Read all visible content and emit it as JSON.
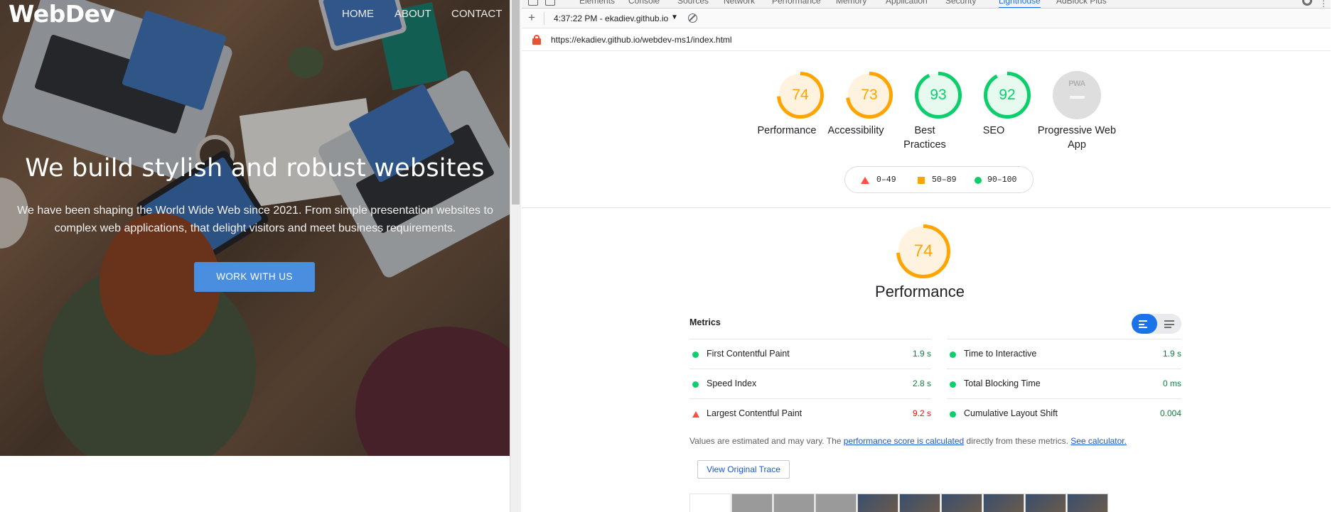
{
  "site": {
    "brand": "WebDev",
    "nav": [
      "HOME",
      "ABOUT",
      "CONTACT"
    ],
    "hero_title": "We build stylish and robust websites",
    "hero_subtitle": "We have been shaping the World Wide Web since 2021. From simple presentation websites to complex web applications, that delight visitors and meet business requirements.",
    "cta_label": "WORK WITH US"
  },
  "devtools": {
    "tabs": [
      "Elements",
      "Console",
      "Sources",
      "Network",
      "Performance",
      "Memory",
      "Application",
      "Security",
      "Lighthouse",
      "AdBlock Plus"
    ],
    "active_tab": "Lighthouse",
    "report_selector": "4:37:22 PM - ekadiev.github.io",
    "url": "https://ekadiev.github.io/webdev-ms1/index.html"
  },
  "gauges": [
    {
      "score": 74,
      "label": "Performance",
      "color": "#ffa400",
      "fill": "#fff3e0"
    },
    {
      "score": 73,
      "label": "Accessibility",
      "color": "#ffa400",
      "fill": "#fff3e0"
    },
    {
      "score": 93,
      "label": "Best Practices",
      "color": "#0cce6b",
      "fill": "#e6faef"
    },
    {
      "score": 92,
      "label": "SEO",
      "color": "#0cce6b",
      "fill": "#e6faef"
    }
  ],
  "pwa": {
    "badge": "PWA",
    "label": "Progressive Web App"
  },
  "legend": [
    {
      "range": "0–49",
      "color": "#ff4e42"
    },
    {
      "range": "50–89",
      "color": "#ffa400"
    },
    {
      "range": "90–100",
      "color": "#0cce6b"
    }
  ],
  "performance": {
    "score": 74,
    "title": "Performance",
    "color": "#ffa400"
  },
  "metrics": {
    "heading": "Metrics",
    "left": [
      {
        "name": "First Contentful Paint",
        "value": "1.9 s",
        "status": "pass"
      },
      {
        "name": "Speed Index",
        "value": "2.8 s",
        "status": "pass"
      },
      {
        "name": "Largest Contentful Paint",
        "value": "9.2 s",
        "status": "fail"
      }
    ],
    "right": [
      {
        "name": "Time to Interactive",
        "value": "1.9 s",
        "status": "pass"
      },
      {
        "name": "Total Blocking Time",
        "value": "0 ms",
        "status": "pass"
      },
      {
        "name": "Cumulative Layout Shift",
        "value": "0.004",
        "status": "pass"
      }
    ]
  },
  "note": {
    "prefix": "Values are estimated and may vary. The ",
    "link1": "performance score is calculated",
    "middle": " directly from these metrics. ",
    "link2": "See calculator."
  },
  "trace_button": "View Original Trace"
}
